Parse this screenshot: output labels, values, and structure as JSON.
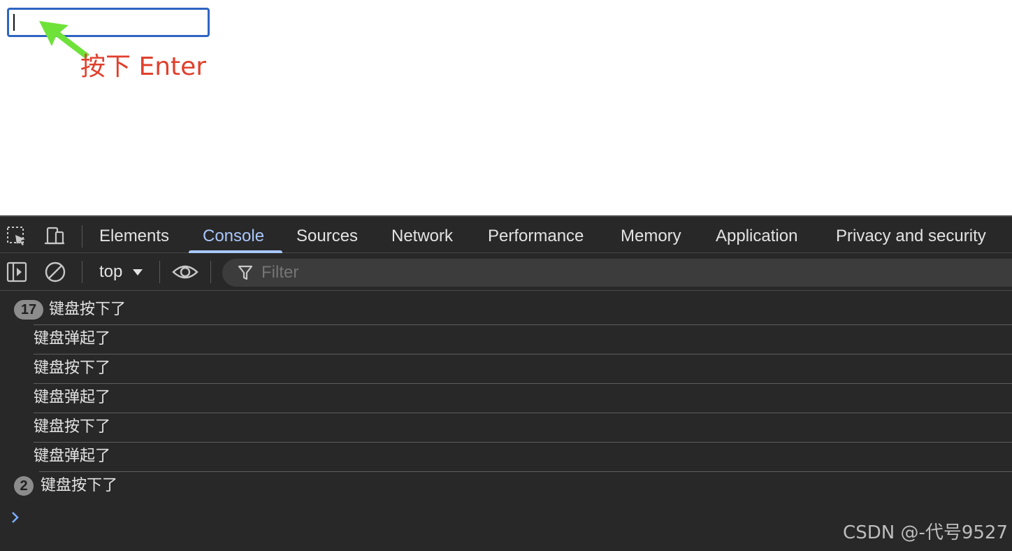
{
  "page": {
    "input_value": "",
    "annotation": "按下 Enter",
    "arrow_color": "#6fe23a",
    "annotation_color": "#e0402c"
  },
  "devtools": {
    "toolbar_icons": [
      "inspect-element-icon",
      "device-toolbar-icon"
    ],
    "tabs": [
      {
        "label": "Elements",
        "active": false
      },
      {
        "label": "Console",
        "active": true
      },
      {
        "label": "Sources",
        "active": false
      },
      {
        "label": "Network",
        "active": false
      },
      {
        "label": "Performance",
        "active": false
      },
      {
        "label": "Memory",
        "active": false
      },
      {
        "label": "Application",
        "active": false
      },
      {
        "label": "Privacy and security",
        "active": false
      }
    ],
    "console_toolbar": {
      "context": "top",
      "filter_placeholder": "Filter"
    },
    "messages": [
      {
        "count": "17",
        "text": "键盘按下了"
      },
      {
        "count": "",
        "text": "键盘弹起了"
      },
      {
        "count": "",
        "text": "键盘按下了"
      },
      {
        "count": "",
        "text": "键盘弹起了"
      },
      {
        "count": "",
        "text": "键盘按下了"
      },
      {
        "count": "",
        "text": "键盘弹起了"
      },
      {
        "count": "2",
        "text": "键盘按下了"
      }
    ],
    "accent_color": "#a8c7fa"
  },
  "watermark": "CSDN @-代号9527"
}
